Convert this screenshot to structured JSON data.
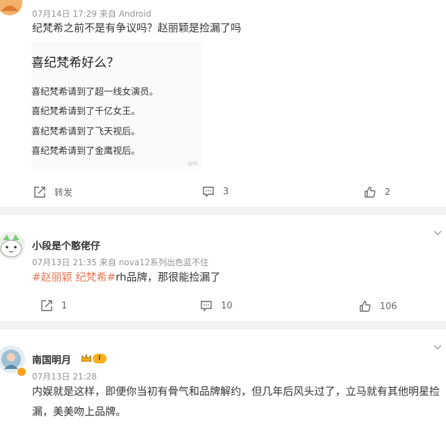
{
  "colors": {
    "topic": "#eb7350",
    "meta": "#939393",
    "separator": "#f2f2f2",
    "badge": "#f6b11e"
  },
  "comment1": {
    "name": "",
    "meta": "07月14日 17:29  来自 Android",
    "text": "纪梵希之前不是有争议吗？赵丽颖是捡漏了吗",
    "image": {
      "title": "喜纪梵希好么？",
      "lines": [
        "喜纪梵希请到了超一线女演员。",
        "喜纪梵希请到了千亿女王。",
        "喜纪梵希请到了飞天视后。",
        "喜纪梵希请到了金鹰视后。"
      ],
      "watermark": "@Ik"
    },
    "actions": {
      "repost_label": "转发",
      "comments": "3",
      "likes": "2"
    }
  },
  "comment2": {
    "name": "小段是个憨佬仔",
    "meta": "07月13日 21:35  来自 nova12系列出色蓝不住",
    "topic1": "#赵丽颖",
    "space": " ",
    "topic2": "纪梵希#",
    "text_rest": "rh品牌，那很能捡漏了",
    "actions": {
      "reposts": "1",
      "comments": "10",
      "likes": "106"
    }
  },
  "comment3": {
    "name": "南国明月",
    "badge_level": "I",
    "meta": "07月13日 21:28",
    "text": "内娱就是这样，即便你当初有骨气和品牌解约，但几年后风头过了，立马就有其他明星捡漏，美美吻上品牌。"
  }
}
